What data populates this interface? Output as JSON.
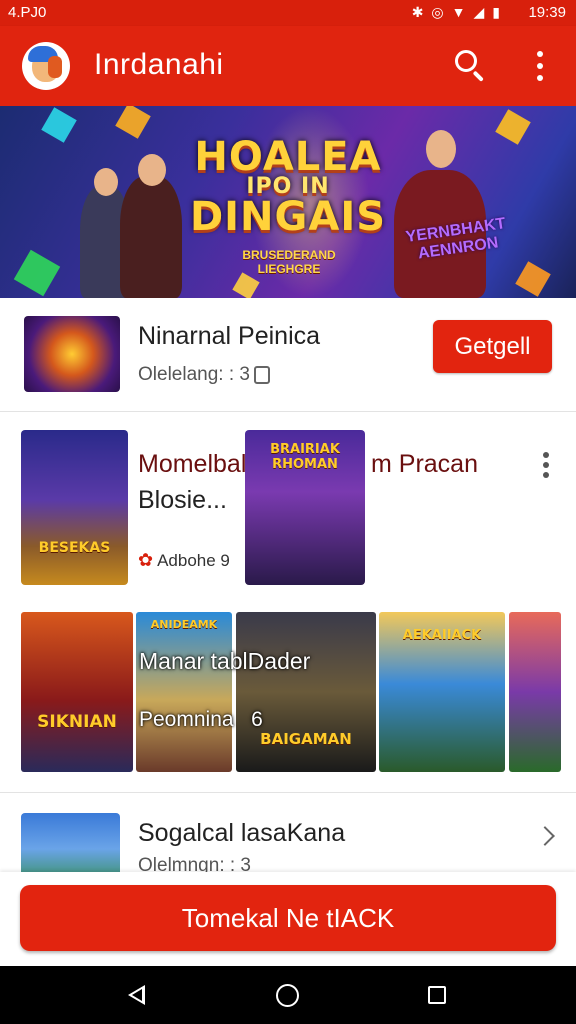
{
  "status_bar": {
    "left_text": "4.PJ0",
    "right_time": "19:39",
    "icons": [
      "bluetooth-icon",
      "alarm-icon",
      "wifi-icon",
      "signal-icon",
      "battery-icon"
    ]
  },
  "app_bar": {
    "title": "Inrdanahi",
    "icons": [
      "avatar",
      "search-icon",
      "more-vert-icon"
    ]
  },
  "banner": {
    "title_top": "HOALEA",
    "title_mid": "IPO IN",
    "title_bottom": "DINGAIS",
    "subtitle": "BRUSEDERAND LIEGHGRE",
    "side_text": "YERNBHAKT AENNRON"
  },
  "featured": {
    "title": "Ninarnal Peinica",
    "meta": "Olelelang: : 3",
    "button_label": "Getgell"
  },
  "card": {
    "title_part1": "Momelbal",
    "title_part2": "m Pracan",
    "title_line2": "Blosie...",
    "meta": "Adbohe 9",
    "thumb_a_text": "BESEKAS",
    "thumb_b_text": "BRAIRIAK RHOMAN"
  },
  "carousel": {
    "overlay_line1": "Manar tablDader",
    "overlay_line2": "Peomnina",
    "overlay_badge": "6",
    "tile_texts": [
      "SIKNIAN",
      "ANIDEAMK",
      "BAIGAMAN",
      "AEKAIIACK",
      ""
    ]
  },
  "row3": {
    "title": "Sogalcal lasaKana",
    "meta": "Olelmngn: : 3"
  },
  "cta": {
    "label": "Tomekal Ne tIACK"
  },
  "colors": {
    "primary": "#e2240f",
    "status_bar": "#d8200c",
    "text": "#222222"
  }
}
